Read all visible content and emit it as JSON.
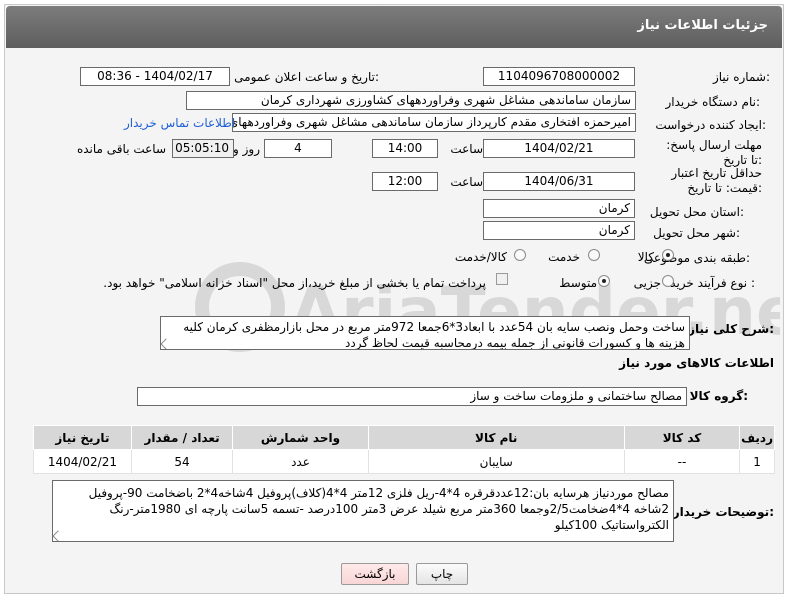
{
  "header": {
    "title": "جزئیات اطلاعات نیاز"
  },
  "fields": {
    "need_number_label": "شماره نیاز:",
    "need_number": "1104096708000002",
    "announce_label": "تاریخ و ساعت اعلان عمومی:",
    "announce_value": "1404/02/17 - 08:36",
    "buyer_org_label": "نام دستگاه خریدار:",
    "buyer_org": "سازمان ساماندهی مشاغل شهری وفراوردههای کشاورزی شهرداری کرمان",
    "creator_label": "ایجاد کننده درخواست:",
    "creator": "امیرحمزه افتخاری مقدم کارپرداز سازمان ساماندهی مشاغل شهری وفراوردههای",
    "contact_link": "اطلاعات تماس خریدار",
    "reply_deadline_label": "مهلت ارسال پاسخ: تا تاریخ:",
    "reply_date": "1404/02/21",
    "time_label": "ساعت",
    "reply_time": "14:00",
    "days_value": "4",
    "days_label": "روز و",
    "remaining_value": "05:05:10",
    "remaining_label": "ساعت باقی مانده",
    "validity_label": "حداقل تاریخ اعتبار قیمت: تا تاریخ:",
    "validity_date": "1404/06/31",
    "validity_time": "12:00",
    "province_label": "استان محل تحویل:",
    "province": "کرمان",
    "city_label": "شهر محل تحویل:",
    "city": "کرمان",
    "category_label": "طبقه بندی موضوعی:",
    "category_options": [
      "کالا",
      "خدمت",
      "کالا/خدمت"
    ],
    "process_label": "نوع فرآیند خرید :",
    "process_options": [
      "جزیی",
      "متوسط"
    ],
    "payment_note": "پرداخت تمام یا بخشی از مبلغ خرید،از محل \"اسناد خزانه اسلامی\" خواهد بود."
  },
  "description": {
    "label": "شرح کلی نیاز:",
    "text": "ساخت وحمل ونصب سایه بان 54عدد با ابعاد3*6جمعا 972متر مربع در محل بازارمظفری کرمان کلیه هزینه ها و کسورات قانونی از جمله بیمه درمحاسبه قیمت لحاظ گردد"
  },
  "goods_section": {
    "title": "اطلاعات کالاهای مورد نیاز",
    "group_label": "گروه کالا:",
    "group_value": "مصالح ساختمانی و ملزومات ساخت و ساز"
  },
  "table": {
    "headers": [
      "ردیف",
      "کد کالا",
      "نام کالا",
      "واحد شمارش",
      "تعداد / مقدار",
      "تاریخ نیاز"
    ],
    "rows": [
      [
        "1",
        "--",
        "سایبان",
        "عدد",
        "54",
        "1404/02/21"
      ]
    ]
  },
  "buyer_notes": {
    "label": "توضیحات خریدار:",
    "text": "مصالح موردنیاز هرسایه بان:12عددقرقره 4*4-ریل فلزی 12متر 4*4(کلاف)پروفیل 4شاخه4*2 باضخامت 90-پروفیل 2شاخه 4*4ضخامت2/5وجمعا 360متر مربع شیلد عرض 3متر 100درصد -تسمه 5سانت پارچه ای 1980متر-رنگ الکترواستاتیک 100کیلو"
  },
  "buttons": {
    "print": "چاپ",
    "back": "بازگشت"
  },
  "colors": {
    "titlebar": "#6b6b6b",
    "link": "#1f5fd6",
    "back_button": "#fde4e4"
  }
}
